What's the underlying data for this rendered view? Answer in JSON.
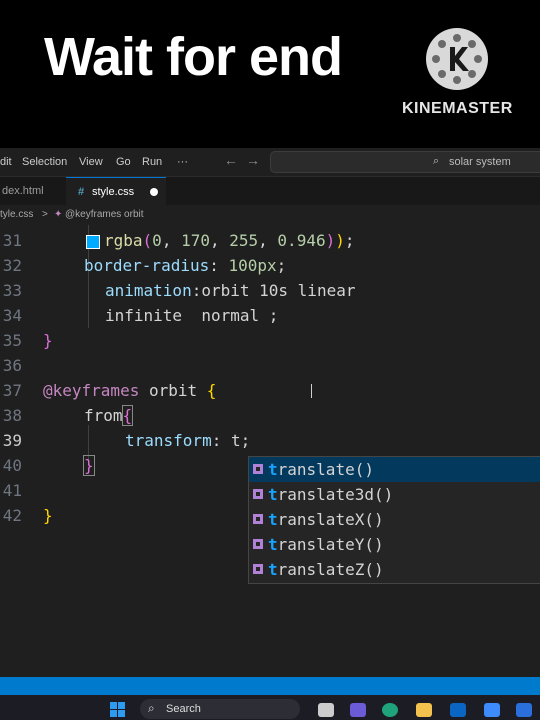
{
  "overlay": {
    "title": "Wait for end",
    "watermark": "KINEMASTER"
  },
  "menubar": {
    "items": [
      "dit",
      "Selection",
      "View",
      "Go",
      "Run",
      "···"
    ],
    "back_icon": "←",
    "forward_icon": "→",
    "search_text": "solar system"
  },
  "tabs": [
    {
      "label": "dex.html"
    },
    {
      "label": "style.css",
      "icon": "#",
      "modified": true
    }
  ],
  "breadcrumb": {
    "file": "tyle.css",
    "separator": ">",
    "symbol": "@keyframes orbit"
  },
  "editor": {
    "line_numbers": [
      "31",
      "32",
      "33",
      "34",
      "35",
      "36",
      "37",
      "38",
      "39",
      "40",
      "41",
      "42"
    ],
    "current_line": "39",
    "line31": {
      "fn": "rgba",
      "open": "(",
      "n1": "0",
      "n2": "170",
      "n3": "255",
      "n4": "0.946",
      "sep": ", ",
      "close": ")",
      "outer_close": ")",
      "semi": ";",
      "swatch_color": "#00aaff"
    },
    "line32": {
      "prop": "border-radius",
      "colon": ": ",
      "value": "100px",
      "semi": ";"
    },
    "line33": {
      "prop": "animation",
      "colon": ":",
      "value": "orbit 10s linear"
    },
    "line34": {
      "value": "infinite  normal ;"
    },
    "line35": {
      "brace": "}"
    },
    "line37": {
      "keyword": "@keyframes",
      "name": " orbit ",
      "brace": "{"
    },
    "line38": {
      "selector": "from",
      "brace": "{"
    },
    "line39": {
      "prop": "transform",
      "colon": ": ",
      "typed": "t;"
    },
    "line40": {
      "brace": "}"
    },
    "line42": {
      "brace": "}"
    }
  },
  "suggestions": [
    {
      "match": "t",
      "rest": "ranslate()",
      "selected": true
    },
    {
      "match": "t",
      "rest": "ranslate3d()"
    },
    {
      "match": "t",
      "rest": "ranslateX()"
    },
    {
      "match": "t",
      "rest": "ranslateY()"
    },
    {
      "match": "t",
      "rest": "ranslateZ()"
    }
  ],
  "taskbar": {
    "search_label": "Search"
  },
  "colors": {
    "statusbar": "#007acc",
    "suggest_match": "#18a3ff",
    "suggest_selected": "#04395e"
  }
}
